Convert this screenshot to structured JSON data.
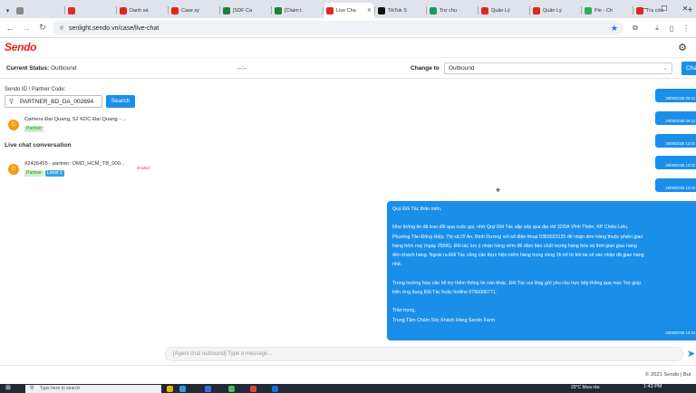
{
  "browser": {
    "tabs": [
      {
        "label": "",
        "color": "#888888",
        "icon": "box-icon"
      },
      {
        "label": "",
        "color": "#d93025",
        "icon": "gmail-icon"
      },
      {
        "label": "Danh sá",
        "color": "#e1251b",
        "icon": "sendo-icon"
      },
      {
        "label": "Case sy",
        "color": "#e1251b",
        "icon": "sendo-icon"
      },
      {
        "label": "[SDF Ca",
        "color": "#188038",
        "icon": "sheets-icon"
      },
      {
        "label": "[Claim t",
        "color": "#188038",
        "icon": "sheets-icon"
      },
      {
        "label": "Live Cha",
        "color": "#e1251b",
        "icon": "sendo-icon"
      },
      {
        "label": "TikTok S",
        "color": "#111111",
        "icon": "tiktok-icon"
      },
      {
        "label": "Trợ chu",
        "color": "#1a9a5e",
        "icon": "chat-icon"
      },
      {
        "label": "Quản Lý",
        "color": "#e1251b",
        "icon": "sendo-icon"
      },
      {
        "label": "Quản Lý",
        "color": "#e1251b",
        "icon": "sendo-icon"
      },
      {
        "label": "Pie - Ch",
        "color": "#34a853",
        "icon": "pie-icon"
      },
      {
        "label": "Tra cứu",
        "color": "#e1251b",
        "icon": "sendo-icon"
      }
    ],
    "active_tab": 6,
    "url": "senlight.sendo.vn/case/live-chat"
  },
  "app": {
    "logo": "Sendo",
    "brand_color": "#e1251b",
    "accent_color": "#1a8fea"
  },
  "status": {
    "current_label": "Current Status:",
    "current_value": "Outbound",
    "timer": "--:--",
    "change_label": "Change to",
    "change_value": "Outbound",
    "change_button": "Cha"
  },
  "search": {
    "label": "Sendo ID / Partner Code:",
    "value": "PARTNER_BD_DA_002694",
    "button": "Search"
  },
  "contacts": [
    {
      "avatar": "C",
      "title": "Camera Đại Quang, 52 KDC Đại Quang - ...",
      "badges": [
        "Partner"
      ]
    }
  ],
  "conversations": {
    "heading": "Live chat conversation",
    "items": [
      {
        "avatar": "C",
        "title": "#2426455 - partner: OMD_HCM_TB_000...",
        "badges": [
          "Partner",
          "Level 1"
        ],
        "status": "Ended"
      }
    ]
  },
  "messages": {
    "small": [
      {
        "time": "25/06/2025 09:12"
      },
      {
        "time": "25/06/2025 09:12"
      },
      {
        "time": "25/06/2025 12:02"
      },
      {
        "time": "25/06/2025 12:03"
      },
      {
        "time": "25/06/2025 12:03"
      }
    ],
    "big": {
      "greeting": "Quý Đối Tác thân mến,",
      "line1": "Như thông tin đã trao đổi qua cuộc gọi, nhờ Quý Đối Tác sắp xếp qua địa chỉ 32/5A Vĩnh Thiên, KP Chiều Liêu,",
      "line2": "Phường Tân Đông Hiệp, Thị xã Dĩ An, Bình Dương với số điện thoại 0383022125 để nhận đơn hàng thuộc phiên giao",
      "line3": "hàng hôm nay (ngày 25/06). Đối tác lưu ý nhận hàng sớm để đảm bảo chất lượng hàng hóa và thời gian giao hàng",
      "line4": "đến khách hàng. Ngoài ra Đối Tác cũng cần thực hiện kiểm hàng trong vòng 3h kể từ khi tài xế xác nhận đã giao hàng",
      "line5": "nhé.",
      "line6": "Trong trường hợp cần hỗ trợ thêm thông tin nào khác, Đối Tác vui lòng gửi yêu cầu trực tiếp thông qua mục Trợ giúp",
      "line7": "trên ứng dụng Đối Tác hoặc hotline 0766006771.",
      "line8": "Trân trọng,",
      "line9": "Trung Tâm Chăm Sóc Khách Hàng Sendo Farm",
      "time": "25/06/2025 13:43"
    }
  },
  "composer": {
    "placeholder": "[Agent chat outbound] Type a message..."
  },
  "footer": {
    "copyright": "© 2021 Sendo | Bui"
  },
  "taskbar": {
    "search_placeholder": "Type here to search",
    "weather": "29°C  Mưa rào",
    "clock": "1:43 PM"
  }
}
